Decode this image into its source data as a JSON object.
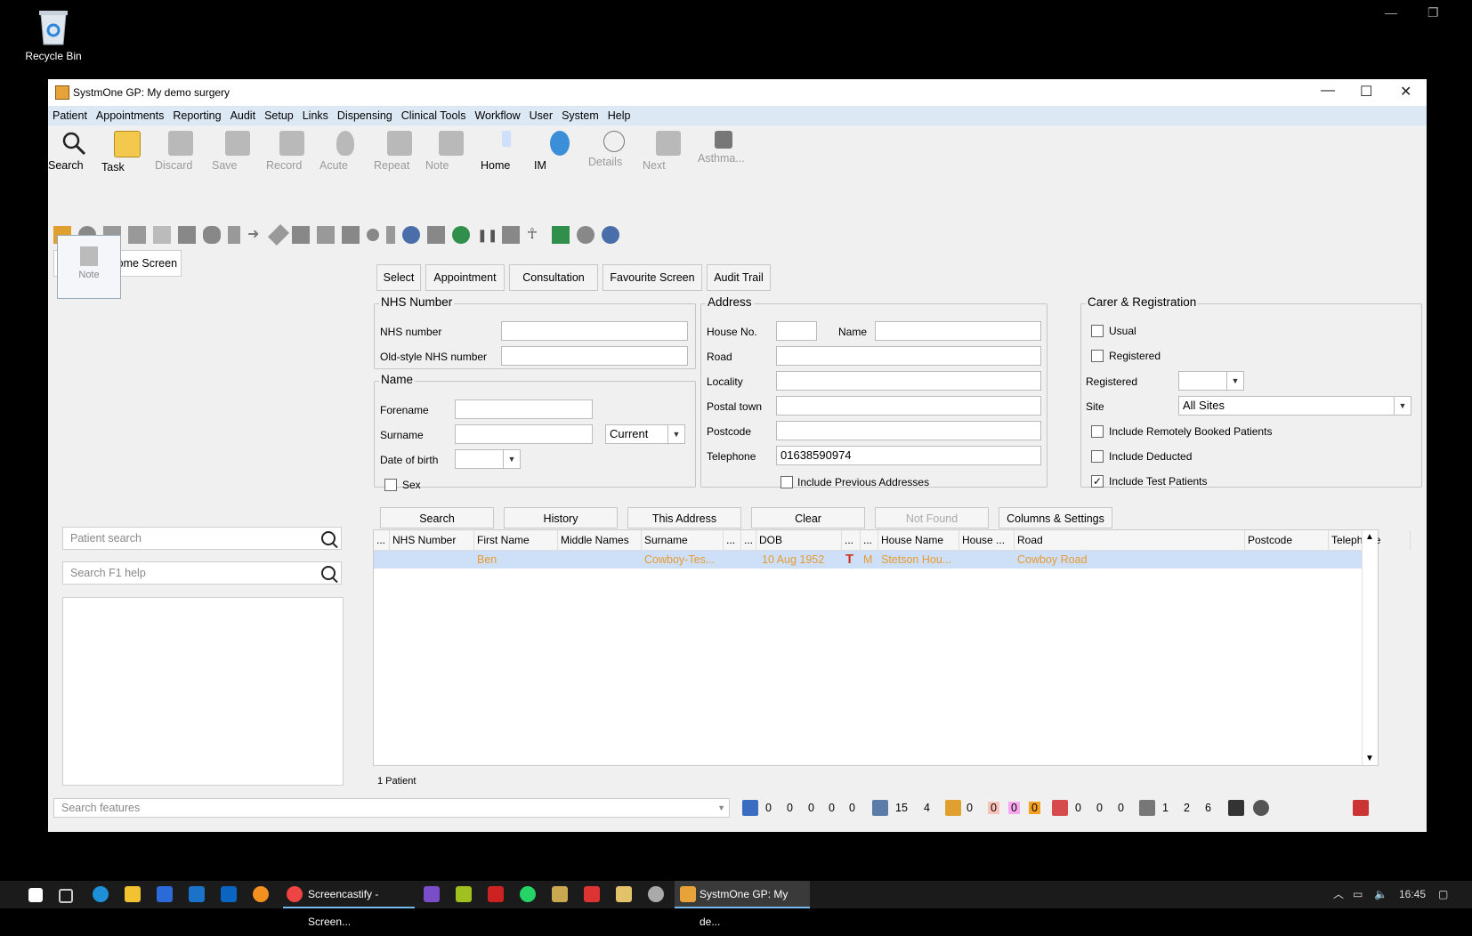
{
  "desktop": {
    "recycle_bin_label": "Recycle Bin"
  },
  "window": {
    "title": "SystmOne GP: My demo surgery",
    "minimize": "—",
    "maximize": "☐",
    "close": "✕"
  },
  "menu": [
    "Patient",
    "Appointments",
    "Reporting",
    "Audit",
    "Setup",
    "Links",
    "Dispensing",
    "Clinical Tools",
    "Workflow",
    "User",
    "System",
    "Help"
  ],
  "toolbar": {
    "buttons": [
      {
        "label": "Search",
        "enabled": true,
        "icon": "search-icon"
      },
      {
        "label": "Task",
        "enabled": true,
        "icon": "task-icon"
      },
      {
        "label": "Discard",
        "enabled": false,
        "icon": "discard-icon"
      },
      {
        "label": "Save",
        "enabled": false,
        "icon": "save-icon"
      },
      {
        "label": "Record",
        "enabled": false,
        "icon": "record-icon"
      },
      {
        "label": "Acute",
        "enabled": false,
        "icon": "acute-icon"
      },
      {
        "label": "Repeat",
        "enabled": false,
        "icon": "repeat-icon"
      },
      {
        "label": "Note",
        "enabled": false,
        "icon": "note-icon"
      },
      {
        "label": "Home",
        "enabled": true,
        "icon": "home-icon"
      },
      {
        "label": "IM",
        "enabled": true,
        "icon": "im-icon"
      },
      {
        "label": "Details",
        "enabled": false,
        "icon": "details-icon"
      },
      {
        "label": "Next",
        "enabled": false,
        "icon": "next-icon"
      },
      {
        "label": "Asthma...",
        "enabled": false,
        "icon": "asthma-icon"
      }
    ],
    "configure_home_screen": "Configure Home Screen"
  },
  "side": {
    "note_tile_label": "Note",
    "patient_search_placeholder": "Patient search",
    "help_search_placeholder": "Search F1 help"
  },
  "tabs": [
    "Select",
    "Appointment",
    "Consultation",
    "Favourite Screen",
    "Audit Trail"
  ],
  "nhs": {
    "title": "NHS Number",
    "nhs_number_label": "NHS number",
    "old_style_label": "Old-style NHS number",
    "nhs_number_value": "",
    "old_style_value": ""
  },
  "name": {
    "title": "Name",
    "forename_label": "Forename",
    "surname_label": "Surname",
    "dob_label": "Date of birth",
    "sex_label": "Sex",
    "current_value": "Current",
    "forename_value": "",
    "surname_value": "",
    "dob_value": ""
  },
  "address": {
    "title": "Address",
    "house_no_label": "House No.",
    "name_label": "Name",
    "road_label": "Road",
    "locality_label": "Locality",
    "postal_town_label": "Postal town",
    "postcode_label": "Postcode",
    "telephone_label": "Telephone",
    "telephone_value": "01638590974",
    "include_prev_label": "Include Previous Addresses"
  },
  "carer": {
    "title": "Carer & Registration",
    "usual_label": "Usual",
    "registered_chk_label": "Registered",
    "registered_label": "Registered",
    "site_label": "Site",
    "site_value": "All Sites",
    "remote_label": "Include Remotely Booked Patients",
    "deducted_label": "Include Deducted",
    "test_label": "Include Test Patients",
    "test_checked": "✓"
  },
  "actions": [
    "Search",
    "History",
    "This Address",
    "Clear",
    "Not Found",
    "Columns & Settings"
  ],
  "grid": {
    "columns": [
      "...",
      "NHS Number",
      "First Name",
      "Middle Names",
      "Surname",
      "...",
      "...",
      "DOB",
      "...",
      "...",
      "House Name",
      "House ...",
      "Road",
      "Postcode",
      "Telephone"
    ],
    "row": {
      "first_name": "Ben",
      "surname": "Cowboy-Tes...",
      "dob": "10 Aug 1952",
      "flag": "T",
      "sex": "M",
      "house_name": "Stetson Hou...",
      "road": "Cowboy Road"
    },
    "count": "1 Patient"
  },
  "statusbar": {
    "search_placeholder": "Search features",
    "group1": [
      "0",
      "0",
      "0",
      "0",
      "0"
    ],
    "group2": [
      "15",
      "4"
    ],
    "group3": [
      "0",
      "0",
      "0",
      "0"
    ],
    "group4": [
      "0",
      "0",
      "0"
    ],
    "group5": [
      "1",
      "2",
      "6"
    ]
  },
  "taskbar": {
    "apps": [
      "Screencastify - Screen...",
      "SystmOne GP: My de..."
    ],
    "clock": "16:45"
  }
}
